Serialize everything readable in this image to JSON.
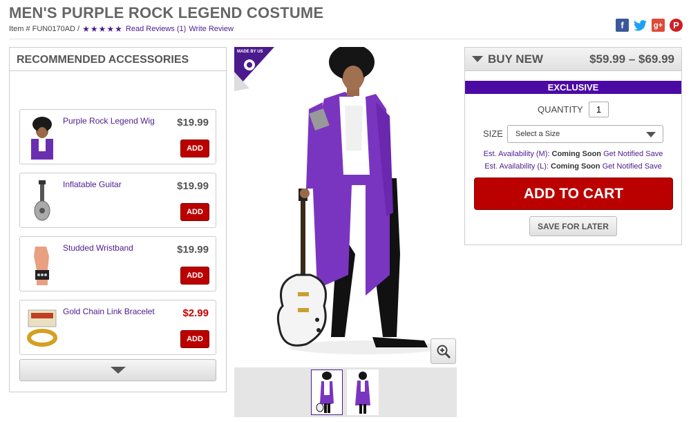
{
  "product": {
    "title": "MEN'S PURPLE ROCK LEGEND COSTUME",
    "item_number": "Item # FUN0170AD /",
    "stars": "★★★★★",
    "read_reviews": "Read Reviews (1)",
    "write_review": "Write Review"
  },
  "social": {
    "facebook": "f",
    "twitter": "🐦",
    "googleplus": "g+",
    "pinterest": "P"
  },
  "accessories": {
    "heading": "RECOMMENDED ACCESSORIES",
    "add_label": "ADD",
    "items": [
      {
        "name": "Purple Rock Legend Wig",
        "price": "$19.99"
      },
      {
        "name": "Inflatable Guitar",
        "price": "$19.99"
      },
      {
        "name": "Studded Wristband",
        "price": "$19.99"
      },
      {
        "name": "Gold Chain Link Bracelet",
        "price": "$2.99"
      }
    ]
  },
  "badge": {
    "text": "MADE BY US"
  },
  "buy": {
    "heading": "BUY NEW",
    "price_range": "$59.99 – $69.99",
    "exclusive": "EXCLUSIVE",
    "quantity_label": "QUANTITY",
    "quantity_value": "1",
    "size_label": "SIZE",
    "size_placeholder": "Select a Size",
    "avail_m_label": "Est. Availability (M):",
    "avail_l_label": "Est. Availability (L):",
    "coming_soon": "Coming Soon",
    "get_notified": "Get Notified",
    "save": "Save",
    "add_to_cart": "ADD TO CART",
    "save_for_later": "SAVE FOR LATER"
  },
  "colors": {
    "brand_purple": "#4b1b8e",
    "exclusive_bar": "#4b0aa4",
    "cta_red": "#bb0000"
  }
}
